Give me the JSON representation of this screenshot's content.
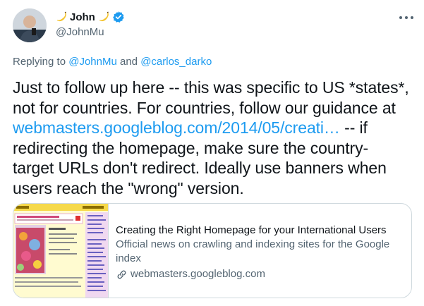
{
  "author": {
    "name": "John",
    "handle": "@JohnMu",
    "verified_color": "#1d9bf0",
    "name_icons": [
      "banana-icon",
      "banana-icon",
      "verified-badge-icon"
    ]
  },
  "reply": {
    "prefix": "Replying to",
    "user1": "@JohnMu",
    "and": "and",
    "user2": "@carlos_darko"
  },
  "tweet": {
    "line1": "Just to follow up here -- this was specific to US *states*,",
    "line2": "not for countries. For countries, follow our guidance at",
    "link": "webmasters.googleblog.com/2014/05/creati…",
    "line3_rest": " -- if",
    "line4": "redirecting the homepage, make sure the country-",
    "line5": "target URLs don't redirect. Ideally use banners when",
    "line6": "users reach the \"wrong\" version."
  },
  "card": {
    "title": "Creating the Right Homepage for your International Users",
    "description": "Official news on crawling and indexing sites for the Google index",
    "domain": "webmasters.googleblog.com",
    "domain_icon": "link-icon"
  },
  "colors": {
    "accent": "#1d9bf0",
    "text": "#0f1419",
    "secondary": "#536471",
    "border": "#cfd9de"
  }
}
